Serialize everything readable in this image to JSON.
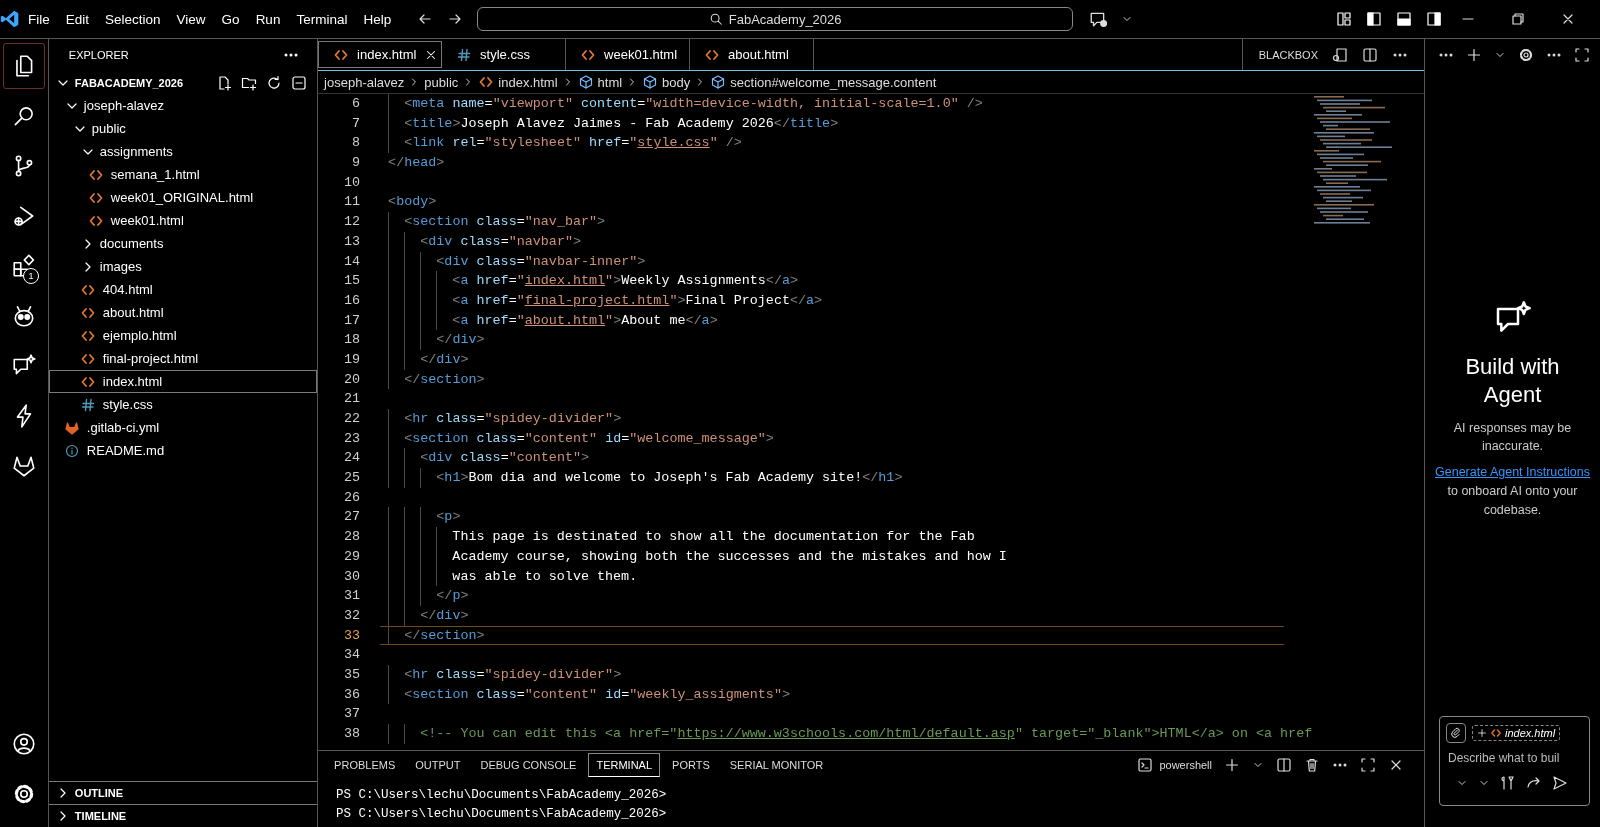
{
  "title_bar": {
    "menu": [
      "File",
      "Edit",
      "Selection",
      "View",
      "Go",
      "Run",
      "Terminal",
      "Help"
    ],
    "search": "FabAcademy_2026"
  },
  "activity_bar": {
    "items": [
      {
        "kind": "files",
        "selected": true
      },
      {
        "kind": "search",
        "selected": false
      },
      {
        "kind": "source-control",
        "selected": false
      },
      {
        "kind": "run-debug",
        "selected": false
      },
      {
        "kind": "extensions",
        "selected": false,
        "badge": "1"
      },
      {
        "kind": "robot",
        "selected": false
      },
      {
        "kind": "chat",
        "selected": false
      },
      {
        "kind": "lightning",
        "selected": false
      },
      {
        "kind": "gitlab",
        "selected": false
      }
    ],
    "bottom": [
      {
        "kind": "account"
      },
      {
        "kind": "settings"
      }
    ]
  },
  "sidebar": {
    "title": "EXPLORER",
    "root": "FABACADEMY_2026",
    "tree": [
      {
        "label": "joseph-alavez",
        "kind": "folder",
        "expanded": true,
        "selected": false,
        "children": [
          {
            "label": "public",
            "kind": "folder",
            "expanded": true,
            "selected": false,
            "children": [
              {
                "label": "assignments",
                "kind": "folder",
                "expanded": true,
                "selected": false,
                "children": [
                  {
                    "label": "semana_1.html",
                    "kind": "html",
                    "selected": false
                  },
                  {
                    "label": "week01_ORIGINAL.html",
                    "kind": "html",
                    "selected": false
                  },
                  {
                    "label": "week01.html",
                    "kind": "html",
                    "selected": false
                  }
                ]
              },
              {
                "label": "documents",
                "kind": "folder",
                "expanded": false,
                "selected": false
              },
              {
                "label": "images",
                "kind": "folder",
                "expanded": false,
                "selected": false
              },
              {
                "label": "404.html",
                "kind": "html",
                "selected": false
              },
              {
                "label": "about.html",
                "kind": "html",
                "selected": false
              },
              {
                "label": "ejemplo.html",
                "kind": "html",
                "selected": false
              },
              {
                "label": "final-project.html",
                "kind": "html",
                "selected": false
              },
              {
                "label": "index.html",
                "kind": "html",
                "selected": true
              },
              {
                "label": "style.css",
                "kind": "css",
                "selected": false
              }
            ]
          }
        ]
      },
      {
        "label": ".gitlab-ci.yml",
        "kind": "yml",
        "selected": false
      },
      {
        "label": "README.md",
        "kind": "md",
        "selected": false
      }
    ],
    "sections": [
      {
        "label": "OUTLINE",
        "expanded": false
      },
      {
        "label": "TIMELINE",
        "expanded": false
      }
    ]
  },
  "editor": {
    "tabs": [
      {
        "label": "index.html",
        "kind": "html",
        "selected": true
      },
      {
        "label": "style.css",
        "kind": "css",
        "selected": false
      },
      {
        "label": "week01.html",
        "kind": "html",
        "selected": false
      },
      {
        "label": "about.html",
        "kind": "html",
        "selected": false
      }
    ],
    "actions_label": "BLACKBOX",
    "breadcrumbs": [
      {
        "label": "joseph-alavez",
        "kind": "folder"
      },
      {
        "label": "public",
        "kind": "folder"
      },
      {
        "label": "index.html",
        "kind": "html"
      },
      {
        "label": "html",
        "kind": "element"
      },
      {
        "label": "body",
        "kind": "element"
      },
      {
        "label": "section#welcome_message.content",
        "kind": "element"
      }
    ],
    "lines": [
      {
        "number": "6",
        "code": "  <meta name=\"viewport\" content=\"width=device-width, initial-scale=1.0\" />",
        "current": false
      },
      {
        "number": "7",
        "code": "  <title>Joseph Alavez Jaimes - Fab Academy 2026</title>",
        "current": false
      },
      {
        "number": "8",
        "code": "  <link rel=\"stylesheet\" href=\"style.css\" />",
        "current": false
      },
      {
        "number": "9",
        "code": "</head>",
        "current": false
      },
      {
        "number": "10",
        "current": false
      },
      {
        "number": "11",
        "code": "<body>",
        "current": false
      },
      {
        "number": "12",
        "code": "  <section class=\"nav_bar\">",
        "current": false
      },
      {
        "number": "13",
        "code": "    <div class=\"navbar\">",
        "current": false
      },
      {
        "number": "14",
        "code": "      <div class=\"navbar-inner\">",
        "current": false
      },
      {
        "number": "15",
        "code": "        <a href=\"index.html\">Weekly Assignments</a>",
        "current": false
      },
      {
        "number": "16",
        "code": "        <a href=\"final-project.html\">Final Project</a>",
        "current": false
      },
      {
        "number": "17",
        "code": "        <a href=\"about.html\">About me</a>",
        "current": false
      },
      {
        "number": "18",
        "code": "      </div>",
        "current": false
      },
      {
        "number": "19",
        "code": "    </div>",
        "current": false
      },
      {
        "number": "20",
        "code": "  </section>",
        "current": false
      },
      {
        "number": "21",
        "current": false
      },
      {
        "number": "22",
        "code": "  <hr class=\"spidey-divider\">",
        "current": false
      },
      {
        "number": "23",
        "code": "  <section class=\"content\" id=\"welcome_message\">",
        "current": false
      },
      {
        "number": "24",
        "code": "    <div class=\"content\">",
        "current": false
      },
      {
        "number": "25",
        "code": "      <h1>Bom dia and welcome to Joseph's Fab Academy site!</h1>",
        "current": false
      },
      {
        "number": "26",
        "current": false
      },
      {
        "number": "27",
        "code": "      <p>",
        "current": false
      },
      {
        "number": "28",
        "code": "        This page is destinated to show all the documentation for the Fab",
        "current": false
      },
      {
        "number": "29",
        "code": "        Academy course, showing both the successes and the mistakes and how I",
        "current": false
      },
      {
        "number": "30",
        "code": "        was able to solve them.",
        "current": false
      },
      {
        "number": "31",
        "code": "      </p>",
        "current": false
      },
      {
        "number": "32",
        "code": "    </div>",
        "current": false
      },
      {
        "number": "33",
        "code": "  </section>",
        "current": true
      },
      {
        "number": "34",
        "current": false
      },
      {
        "number": "35",
        "code": "  <hr class=\"spidey-divider\">",
        "current": false
      },
      {
        "number": "36",
        "code": "  <section class=\"content\" id=\"weekly_assigments\">",
        "current": false
      },
      {
        "number": "37",
        "current": false
      },
      {
        "number": "38",
        "code": "    <!-- You can edit this <a href=\"https://www.w3schools.com/html/default.asp\" target=\"_blank\">HTML</a> on <a href",
        "current": false
      }
    ]
  },
  "panel": {
    "tabs": [
      {
        "label": "PROBLEMS",
        "selected": false
      },
      {
        "label": "OUTPUT",
        "selected": false
      },
      {
        "label": "DEBUG CONSOLE",
        "selected": false
      },
      {
        "label": "TERMINAL",
        "selected": true
      },
      {
        "label": "PORTS",
        "selected": false
      },
      {
        "label": "SERIAL MONITOR",
        "selected": false
      }
    ],
    "shell": "powershell",
    "terminal_lines": [
      "PS C:\\Users\\lechu\\Documents\\FabAcademy_2026>",
      "PS C:\\Users\\lechu\\Documents\\FabAcademy_2026>"
    ]
  },
  "chat": {
    "heading": "Build with Agent",
    "note": "AI responses may be inaccurate.",
    "link": "Generate Agent Instructions",
    "after_link": " to onboard AI onto your codebase.",
    "attachment": "index.html",
    "placeholder": "Describe what to buil"
  }
}
